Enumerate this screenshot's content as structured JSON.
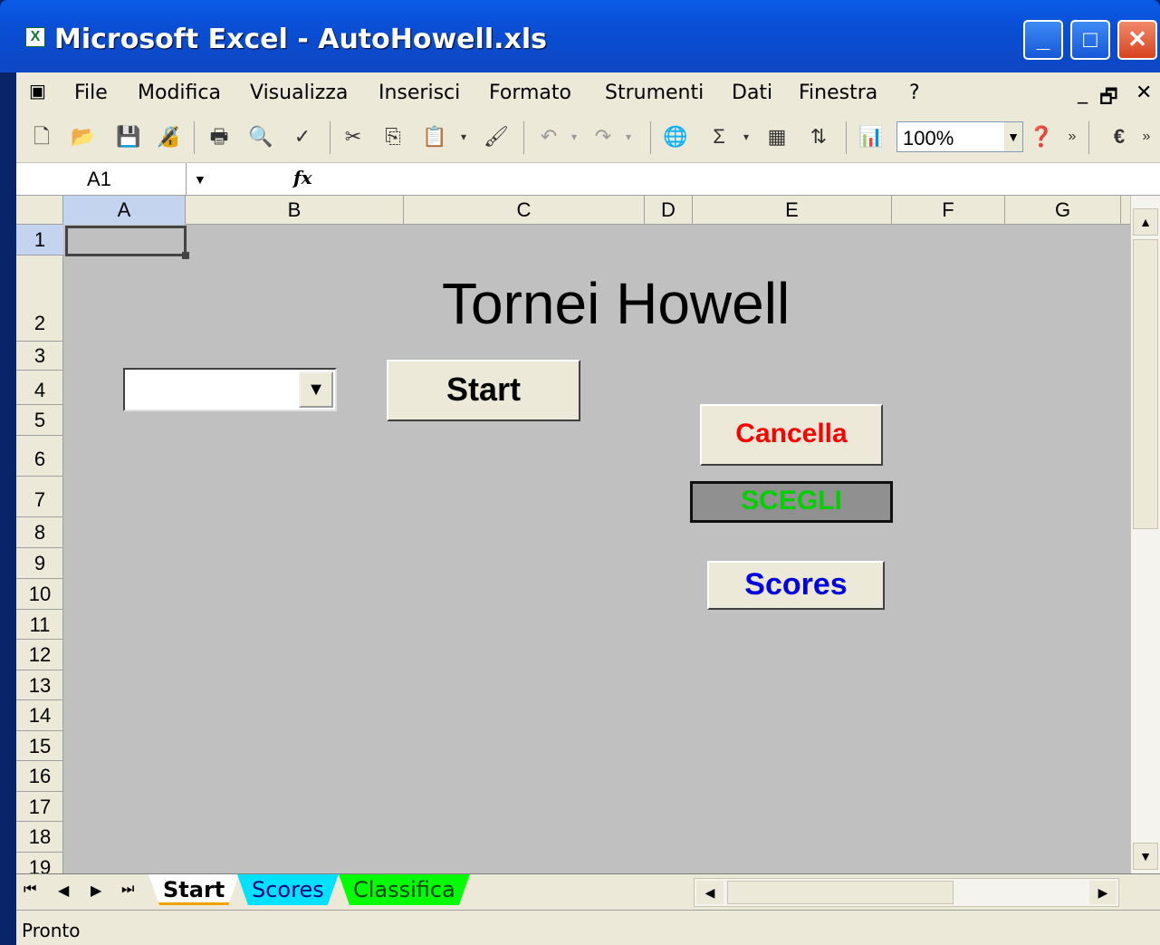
{
  "window": {
    "title": "Microsoft Excel - AutoHowell.xls",
    "app_icon": "excel-icon",
    "minimize_glyph": "_",
    "maximize_glyph": "□",
    "close_glyph": "✕"
  },
  "menu": {
    "items": [
      "File",
      "Modifica",
      "Visualizza",
      "Inserisci",
      "Formato",
      "Strumenti",
      "Dati",
      "Finestra",
      "?"
    ],
    "doc_controls": [
      "_",
      "🗗",
      "✕"
    ]
  },
  "toolbar": {
    "icons": [
      "new-icon",
      "open-icon",
      "save-icon",
      "permission-icon",
      "print-icon",
      "print-preview-icon",
      "spelling-icon",
      "cut-icon",
      "copy-icon",
      "paste-icon",
      "format-painter-icon",
      "undo-icon",
      "redo-icon",
      "hyperlink-icon",
      "autosum-icon",
      "euro-icon",
      "sort-asc-icon",
      "chart-wizard-icon",
      "help-icon"
    ],
    "zoom": "100%"
  },
  "formula_bar": {
    "name_box": "A1",
    "fx": "fx",
    "content": ""
  },
  "sheet": {
    "columns": [
      "A",
      "B",
      "C",
      "D",
      "E",
      "F",
      "G"
    ],
    "rows": [
      "1",
      "2",
      "3",
      "4",
      "5",
      "6",
      "7",
      "8",
      "9",
      "10",
      "11",
      "12",
      "13",
      "14",
      "15",
      "16",
      "17",
      "18",
      "19"
    ],
    "heading": "Tornei Howell",
    "combo_value": "",
    "buttons": {
      "start": "Start",
      "cancella": "Cancella",
      "scegli": "SCEGLI",
      "scores": "Scores"
    }
  },
  "tabs": [
    "Start",
    "Scores",
    "Classifica"
  ],
  "status": "Pronto",
  "colors": {
    "sheet_bg": "#c0c0c0",
    "cancella": "#ff0000",
    "scegli": "#00d000",
    "scores": "#0000e0",
    "tab_scores": "#00e0ff",
    "tab_classifica": "#00ff00"
  }
}
